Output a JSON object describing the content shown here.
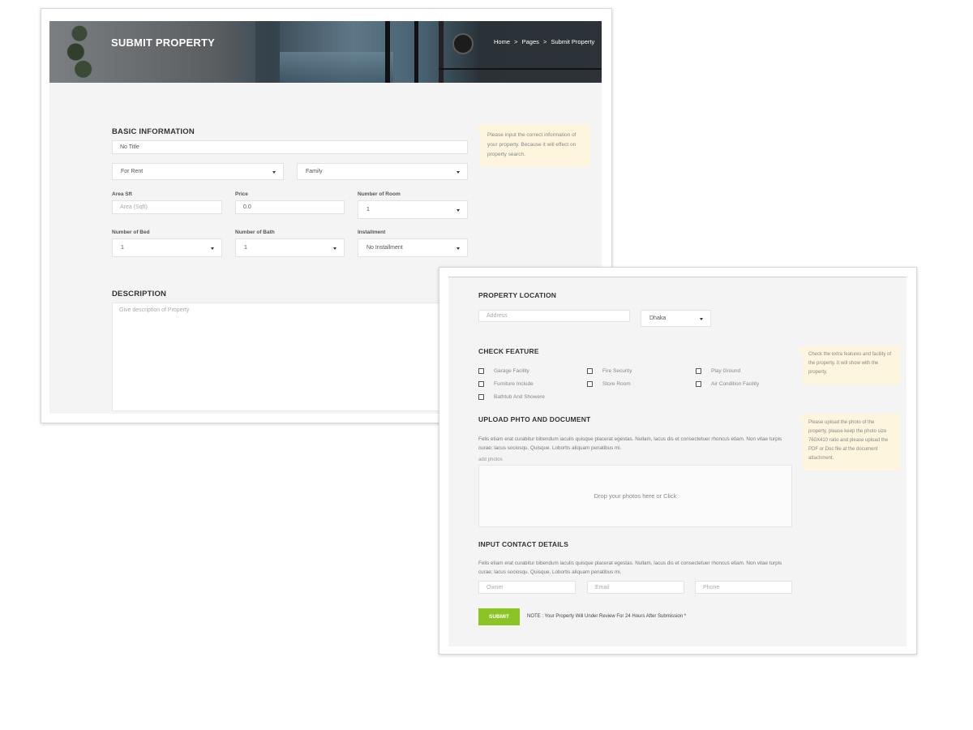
{
  "header": {
    "title": "SUBMIT PROPERTY",
    "breadcrumb": [
      "Home",
      ">",
      "Pages",
      ">",
      "Submit Property"
    ]
  },
  "basic_info": {
    "title": "BASIC INFORMATION",
    "title_field_value": "No Title",
    "status_select": "For Rent",
    "type_select": "Family",
    "area_label": "Area Sft",
    "area_placeholder": "Area (Sqft)",
    "price_label": "Price",
    "price_value": "0.0",
    "rooms_label": "Number of Room",
    "rooms_value": "1",
    "bed_label": "Number of Bed",
    "bed_value": "1",
    "bath_label": "Number of Bath",
    "bath_value": "1",
    "installment_label": "Installment",
    "installment_value": "No Installment",
    "note": "Please input the correct information of your property. Because it will effect on property search."
  },
  "description": {
    "title": "DESCRIPTION",
    "placeholder": "Give description of Property"
  },
  "location": {
    "title": "PROPERTY LOCATION",
    "address_placeholder": "Address",
    "city_value": "Dhaka"
  },
  "features": {
    "title": "CHECK FEATURE",
    "items": [
      "Garage Facility",
      "Fire Security",
      "Play Ground",
      "Furniture Include",
      "Store Room",
      "Air Condition Facility",
      "Bathtub And Showere"
    ],
    "note": "Check the extra features and facility of the property. It will show with the property."
  },
  "upload": {
    "title": "UPLOAD PHTO AND DOCUMENT",
    "paragraph": "Felis etiam erat curabitur bibendum iaculis quisque placerat egestas. Nullam, lacus dis et consectetuer rhoncus etiam. Non vitae turpis curae; lacus sociosqu. Quisque. Lobortis aliquam penatibus mi.",
    "add_label": "add photos",
    "drop_text": "Drop your photos here or Click",
    "note": "Please upload the photo of the property, please keep the photo size 760X410 ratio and please upload the PDF or Doc file at the document attachment."
  },
  "contact": {
    "title": "INPUT CONTACT DETAILS",
    "paragraph": "Felis etiam erat curabitur bibendum iaculis quisque placerat egestas. Nullam, lacus dis et consectetuer rhoncus etiam. Non vitae turpis curae; lacus sociosqu. Quisque. Lobortis aliquam penatibus mi.",
    "owner_placeholder": "Owner",
    "email_placeholder": "Email",
    "phone_placeholder": "Phone",
    "submit_label": "SUBMIT",
    "submit_note": "NOTE : Your Property Will Under Review For 24 Hours After Submission *"
  },
  "colors": {
    "accent": "#8dc425",
    "note_bg": "#fdf5dd",
    "panel_bg": "#f4f4f4"
  }
}
